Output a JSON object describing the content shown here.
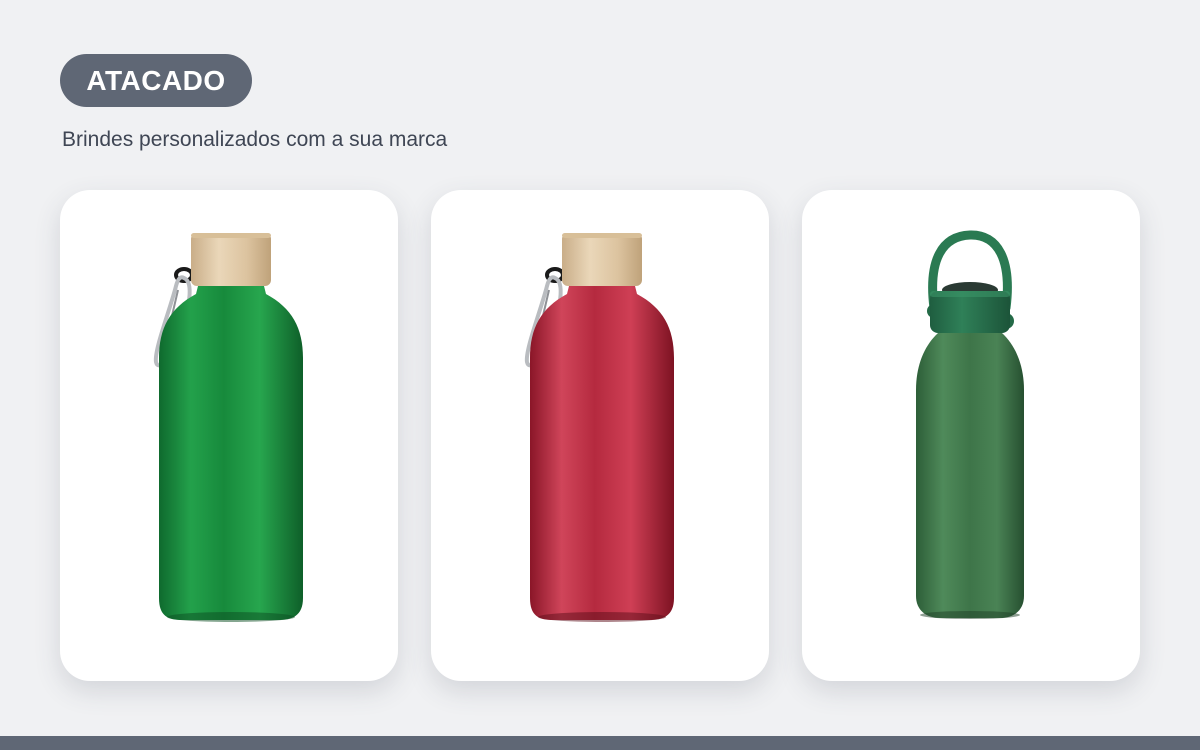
{
  "header": {
    "badge_label": "ATACADO",
    "subtitle": "Brindes personalizados com a sua marca"
  },
  "products": [
    {
      "name": "green-aluminum-bottle-bamboo-cap",
      "body_color": "#1f9444",
      "cap": "bamboo",
      "accessory": "carabiner"
    },
    {
      "name": "red-aluminum-bottle-bamboo-cap",
      "body_color": "#b8283c",
      "cap": "bamboo",
      "accessory": "carabiner"
    },
    {
      "name": "dark-green-bottle-handle-cap",
      "body_color": "#3f7a4c",
      "cap": "green-handle",
      "accessory": "none"
    }
  ],
  "colors": {
    "badge_bg": "#5f6775",
    "page_bg": "#f0f1f3",
    "card_bg": "#ffffff",
    "footer_bar": "#5f6775"
  }
}
